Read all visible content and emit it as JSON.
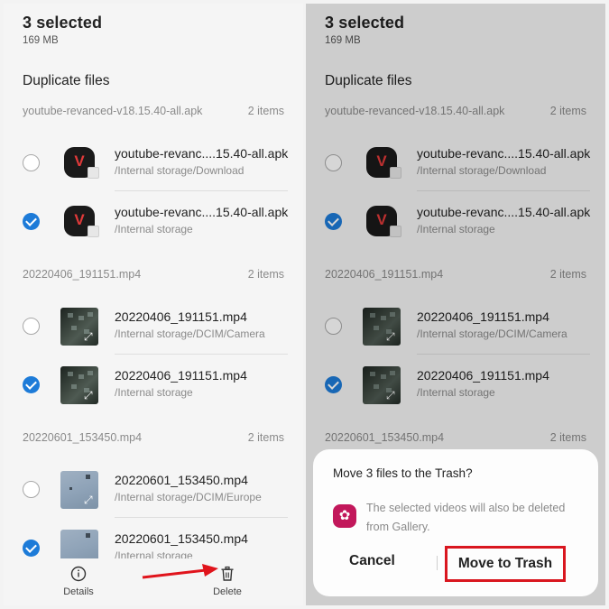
{
  "header": {
    "title": "3 selected",
    "size": "169 MB"
  },
  "section_title": "Duplicate files",
  "groups": [
    {
      "name": "youtube-revanced-v18.15.40-all.apk",
      "count": "2 items",
      "files": [
        {
          "name": "youtube-revanc....15.40-all.apk",
          "path": "/Internal storage/Download",
          "checked": false,
          "thumb": "app"
        },
        {
          "name": "youtube-revanc....15.40-all.apk",
          "path": "/Internal storage",
          "checked": true,
          "thumb": "app"
        }
      ]
    },
    {
      "name": "20220406_191151.mp4",
      "count": "2 items",
      "files": [
        {
          "name": "20220406_191151.mp4",
          "path": "/Internal storage/DCIM/Camera",
          "checked": false,
          "thumb": "video"
        },
        {
          "name": "20220406_191151.mp4",
          "path": "/Internal storage",
          "checked": true,
          "thumb": "video"
        }
      ]
    },
    {
      "name": "20220601_153450.mp4",
      "count": "2 items",
      "files": [
        {
          "name": "20220601_153450.mp4",
          "path": "/Internal storage/DCIM/Europe",
          "checked": false,
          "thumb": "image"
        },
        {
          "name": "20220601_153450.mp4",
          "path": "/Internal storage",
          "checked": true,
          "thumb": "image"
        }
      ]
    }
  ],
  "bottom_bar": {
    "details_label": "Details",
    "details_icon": "info-icon",
    "delete_label": "Delete",
    "delete_icon": "trash-icon"
  },
  "dialog": {
    "title": "Move 3 files to the Trash?",
    "message": "The selected videos will also be deleted from Gallery.",
    "icon": "gallery-flower-icon",
    "cancel_label": "Cancel",
    "confirm_label": "Move to Trash"
  },
  "colors": {
    "accent": "#1d7bd8",
    "highlight": "#d9161f",
    "gallery_icon": "#c2185b"
  }
}
